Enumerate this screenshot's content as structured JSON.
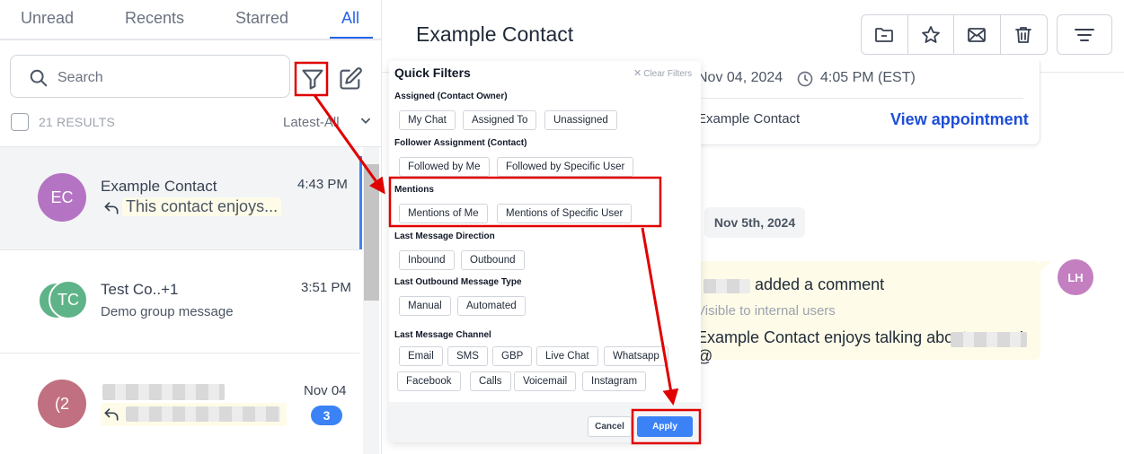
{
  "tabs": [
    {
      "label": "Unread"
    },
    {
      "label": "Recents"
    },
    {
      "label": "Starred"
    },
    {
      "label": "All",
      "active": true
    }
  ],
  "search": {
    "placeholder": "Search"
  },
  "results": {
    "count_label": "21 RESULTS",
    "sort_label": "Latest-All"
  },
  "conversations": [
    {
      "initials": "EC",
      "avatar_color": "#b474c3",
      "name": "Example Contact",
      "time": "4:43 PM",
      "preview": "This contact enjoys..."
    },
    {
      "initials": "TC",
      "avatar_color": "#5fb388",
      "name": "Test Co..+1",
      "time": "3:51 PM",
      "preview": "Demo group message"
    },
    {
      "initials": "(2",
      "avatar_color": "#c07080",
      "time": "Nov 04",
      "unread_count": "3"
    }
  ],
  "contact": {
    "name": "Example Contact"
  },
  "header_actions": [
    "folder-icon",
    "star-icon",
    "mail-icon",
    "trash-icon",
    "filter-lines-icon"
  ],
  "appointment": {
    "date": "Nov 04, 2024",
    "time": "4:05 PM (EST)",
    "contact": "Example Contact",
    "link": "View appointment"
  },
  "timeline": {
    "date_pill": "Nov 5th, 2024"
  },
  "comment": {
    "added": "added a comment",
    "visibility": "Visible to internal users",
    "body": "Example Contact enjoys talking about soccer! @",
    "author_initials": "LH",
    "author_color": "#c37fc0"
  },
  "quick_filters": {
    "title": "Quick Filters",
    "clear": "Clear Filters",
    "sections": [
      {
        "title": "Assigned (Contact Owner)",
        "options": [
          "My Chat",
          "Assigned To",
          "Unassigned"
        ]
      },
      {
        "title": "Follower Assignment (Contact)",
        "options": [
          "Followed by Me",
          "Followed by Specific User"
        ]
      },
      {
        "title": "Mentions",
        "options": [
          "Mentions of Me",
          "Mentions of Specific User"
        ]
      },
      {
        "title": "Last Message Direction",
        "options": [
          "Inbound",
          "Outbound"
        ]
      },
      {
        "title": "Last Outbound Message Type",
        "options": [
          "Manual",
          "Automated"
        ]
      },
      {
        "title": "Last Message Channel",
        "options": [
          "Email",
          "SMS",
          "GBP",
          "Live Chat",
          "Whatsapp",
          "Facebook",
          "Calls",
          "Voicemail",
          "Instagram"
        ]
      }
    ],
    "cancel": "Cancel",
    "apply": "Apply"
  },
  "colors": {
    "accent": "#2563eb",
    "annotation": "#e00000",
    "apply": "#3b82f6"
  }
}
